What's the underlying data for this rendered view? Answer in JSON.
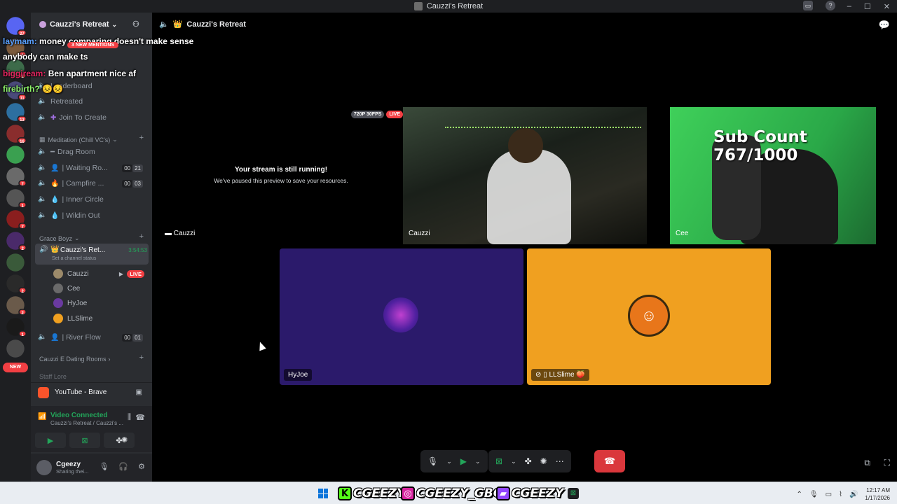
{
  "window": {
    "title": "Cauzzi's Retreat"
  },
  "servers": [
    {
      "badge": "27",
      "color": "#5865f2"
    },
    {
      "badge": "1",
      "color": "#7b5a3c"
    },
    {
      "badge": "1",
      "color": "#3d6b4a"
    },
    {
      "badge": "11",
      "color": "#4a4a7a"
    },
    {
      "badge": "13",
      "color": "#2d6fa0"
    },
    {
      "badge": "16",
      "color": "#8a2d2d"
    },
    {
      "badge": "",
      "color": "#3aa050"
    },
    {
      "badge": "7",
      "color": "#6a6a6a"
    },
    {
      "badge": "1",
      "color": "#555"
    },
    {
      "badge": "7",
      "color": "#8a1e1e"
    },
    {
      "badge": "2",
      "color": "#4a2a6a"
    },
    {
      "badge": "",
      "color": "#3a5a3a"
    },
    {
      "badge": "2",
      "color": "#2a2a2a"
    },
    {
      "badge": "2",
      "color": "#6a5a4a"
    },
    {
      "badge": "1",
      "color": "#1a1a1a"
    },
    {
      "badge": "",
      "color": "#4a4a4a"
    }
  ],
  "new_pill": "NEW",
  "server_header": {
    "name": "Cauzzi's Retreat"
  },
  "overlay_chat": [
    {
      "name": "laymam:",
      "text": "money comparing doesn't make sense anybody can make ts"
    },
    {
      "name": "biggiream:",
      "text": "Ben apartment nice af"
    },
    {
      "name": "firebirth?",
      "text": "😣😣"
    }
  ],
  "mentions_pill": "3 NEW MENTIONS",
  "channels": {
    "partial_top": "Leaderboard",
    "retreated": "Retreated",
    "join_to_create": "Join To Create",
    "cat_meditation": "Meditation (Chill VC's)",
    "drag_room": "Drag Room",
    "waiting_room": "| Waiting Ro...",
    "waiting_counts": [
      "00",
      "21"
    ],
    "campfire": "| Campfire ...",
    "campfire_counts": [
      "00",
      "03"
    ],
    "inner_circle": "| Inner Circle",
    "wildin_out": "| Wildin Out",
    "cat_grace": "Grace Boyz",
    "active_channel": "Cauzzi's Ret...",
    "active_time": "3:54:53",
    "active_status": "Set a channel status",
    "users": [
      {
        "name": "Cauzzi",
        "live": "LIVE",
        "color": "#9c8a6a"
      },
      {
        "name": "Cee",
        "live": "",
        "color": "#6a6a6a"
      },
      {
        "name": "HyJoe",
        "live": "",
        "color": "#6a3aa0"
      },
      {
        "name": "LLSlime",
        "live": "",
        "color": "#f0a020"
      }
    ],
    "river_flow": "| River Flow",
    "river_counts": [
      "00",
      "01"
    ],
    "cat_dating": "Cauzzi E Dating Rooms",
    "cat_staff": "Staff Lore"
  },
  "activity_app": "YouTube - Brave",
  "voice": {
    "title": "Video Connected",
    "sub": "Cauzzi's Retreat / Cauzzi's ..."
  },
  "user": {
    "name": "Cgeezy",
    "status": "Sharing thei..."
  },
  "main": {
    "header": "Cauzzi's Retreat",
    "stream_title": "Your stream is still running!",
    "stream_sub": "We've paused this preview to save your resources.",
    "tile_cauzzi_self": "Cauzzi",
    "res_badge": "720P 30FPS",
    "live_badge": "LIVE",
    "tile_cauzzi": "Cauzzi",
    "tile_cee": "Cee",
    "sub_count": "Sub Count 767/1000",
    "tile_hyjoe": "HyJoe",
    "tile_llslime": "LLSlime"
  },
  "taskbar": {
    "kick": "CGEEZY",
    "instagram": "CGEEZY_GBC",
    "twitch": "CGEEZY",
    "time": "12:17 AM",
    "date": "1/17/2026"
  },
  "colors": {
    "purple_tile": "#2b1a6b",
    "orange_tile": "#f0a020",
    "accent": "#5865f2"
  }
}
